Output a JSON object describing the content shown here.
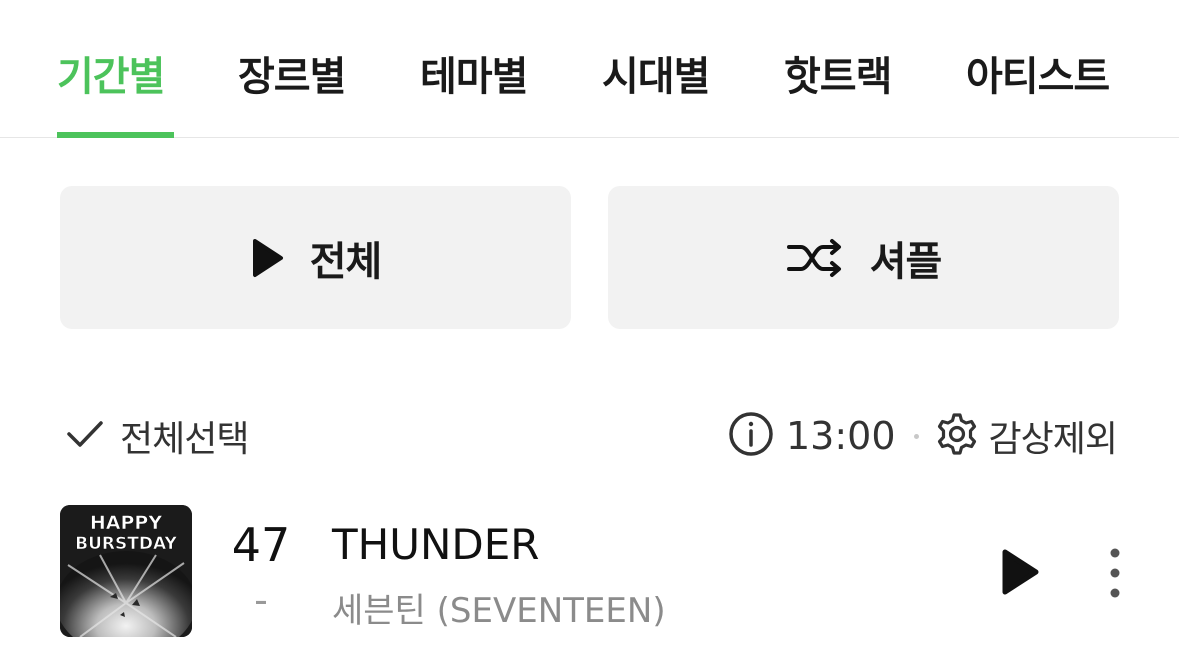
{
  "tabs": [
    {
      "label": "기간별",
      "active": true
    },
    {
      "label": "장르별",
      "active": false
    },
    {
      "label": "테마별",
      "active": false
    },
    {
      "label": "시대별",
      "active": false
    },
    {
      "label": "핫트랙",
      "active": false
    },
    {
      "label": "아티스트",
      "active": false
    }
  ],
  "actions": {
    "play_all_label": "전체",
    "shuffle_label": "셔플"
  },
  "options": {
    "select_all_label": "전체선택",
    "time": "13:00",
    "exclude_label": "감상제외"
  },
  "track": {
    "rank": "47",
    "rank_change": "-",
    "title": "THUNDER",
    "artist": "세븐틴 (SEVENTEEN)",
    "album_text_line1": "HAPPY",
    "album_text_line2": "BURSTDAY"
  },
  "colors": {
    "accent": "#4cc35b",
    "button_bg": "#f2f2f2",
    "muted_text": "#8b8b8b"
  },
  "icons": {
    "play": "play-icon",
    "shuffle": "shuffle-icon",
    "check": "check-icon",
    "info": "info-icon",
    "gear": "gear-icon",
    "more": "more-vertical-icon"
  }
}
